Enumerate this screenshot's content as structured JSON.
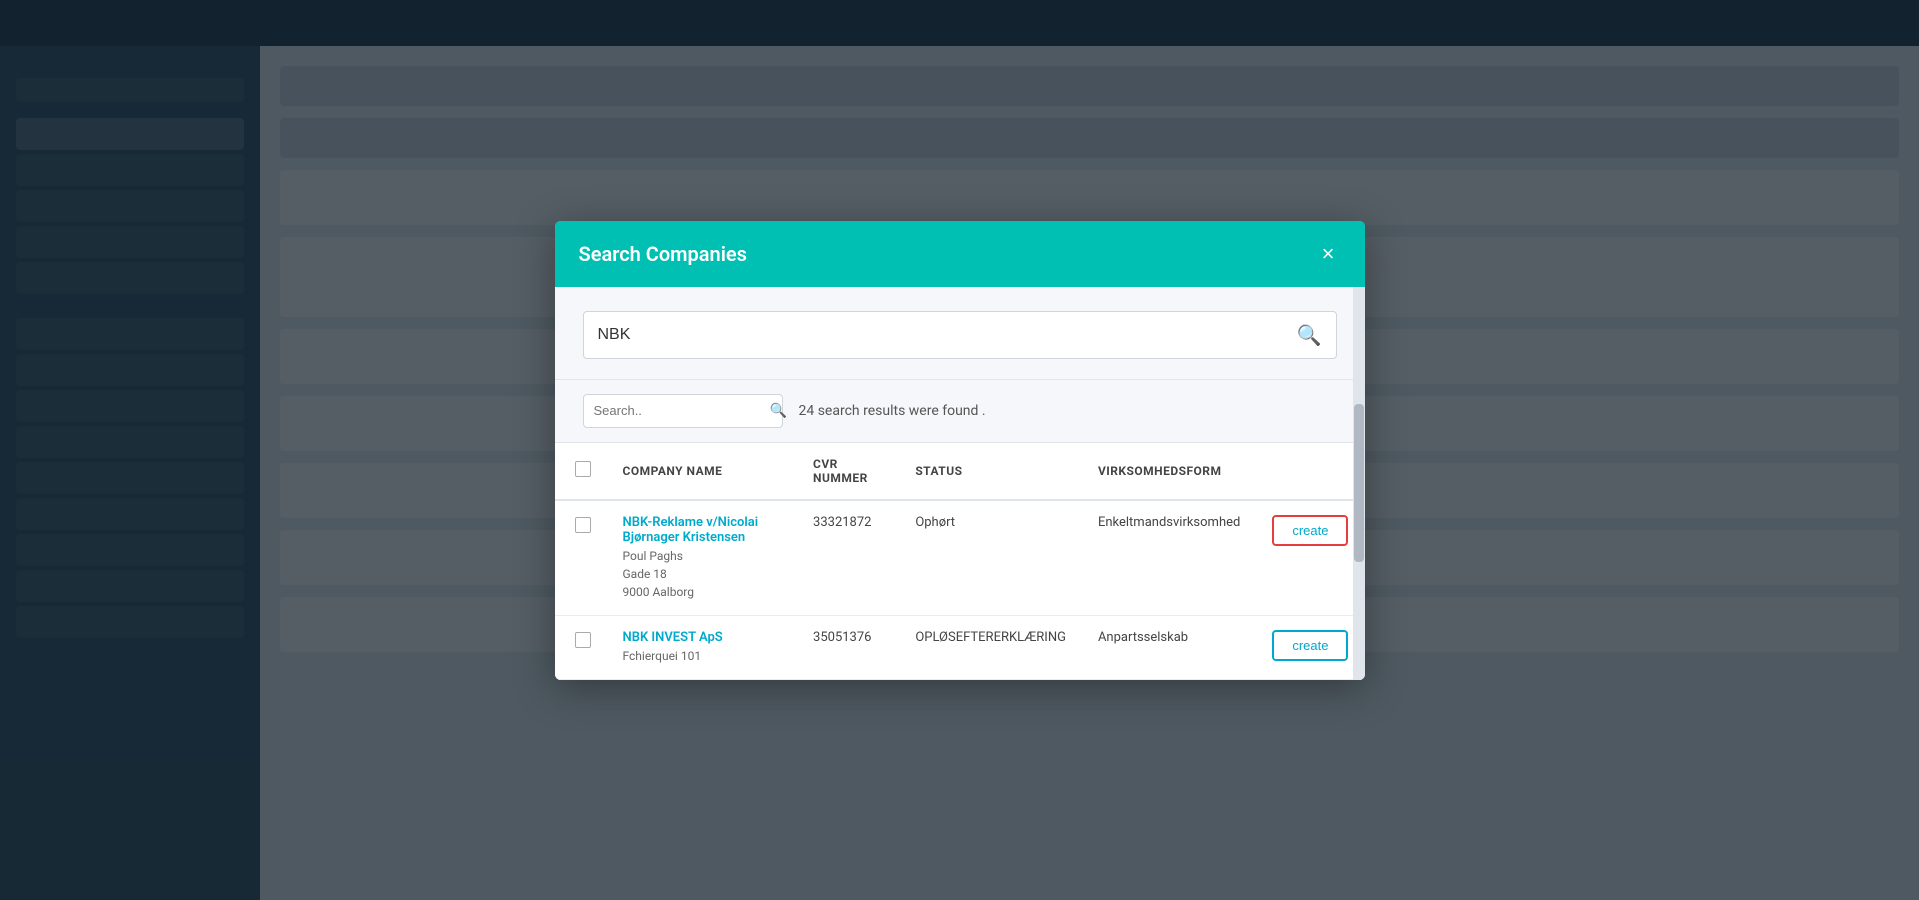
{
  "app": {
    "topbar": {
      "bg": "#1e3444"
    }
  },
  "modal": {
    "title": "Search Companies",
    "close_label": "×",
    "search_value": "NBK",
    "search_placeholder": "Search..",
    "results_text": "24 search results were found .",
    "table": {
      "columns": [
        "",
        "COMPANY NAME",
        "CVR NUMMER",
        "STATUS",
        "VIRKSOMHEDSFORM",
        ""
      ],
      "rows": [
        {
          "company_name": "NBK-Reklame v/Nicolai Bjørnager Kristensen",
          "address": "Poul Paghs\nGade 18\n9000 Aalborg",
          "cvr": "33321872",
          "status": "Ophørt",
          "virksomhedsform": "Enkeltmandsvirksomhed",
          "create_label": "create",
          "highlighted": true
        },
        {
          "company_name": "NBK INVEST ApS",
          "address": "Fchierquei 101",
          "cvr": "35051376",
          "status": "OPLØSEFTERERKLÆRING",
          "virksomhedsform": "Anpartsselskab",
          "create_label": "create",
          "highlighted": false
        }
      ]
    }
  }
}
